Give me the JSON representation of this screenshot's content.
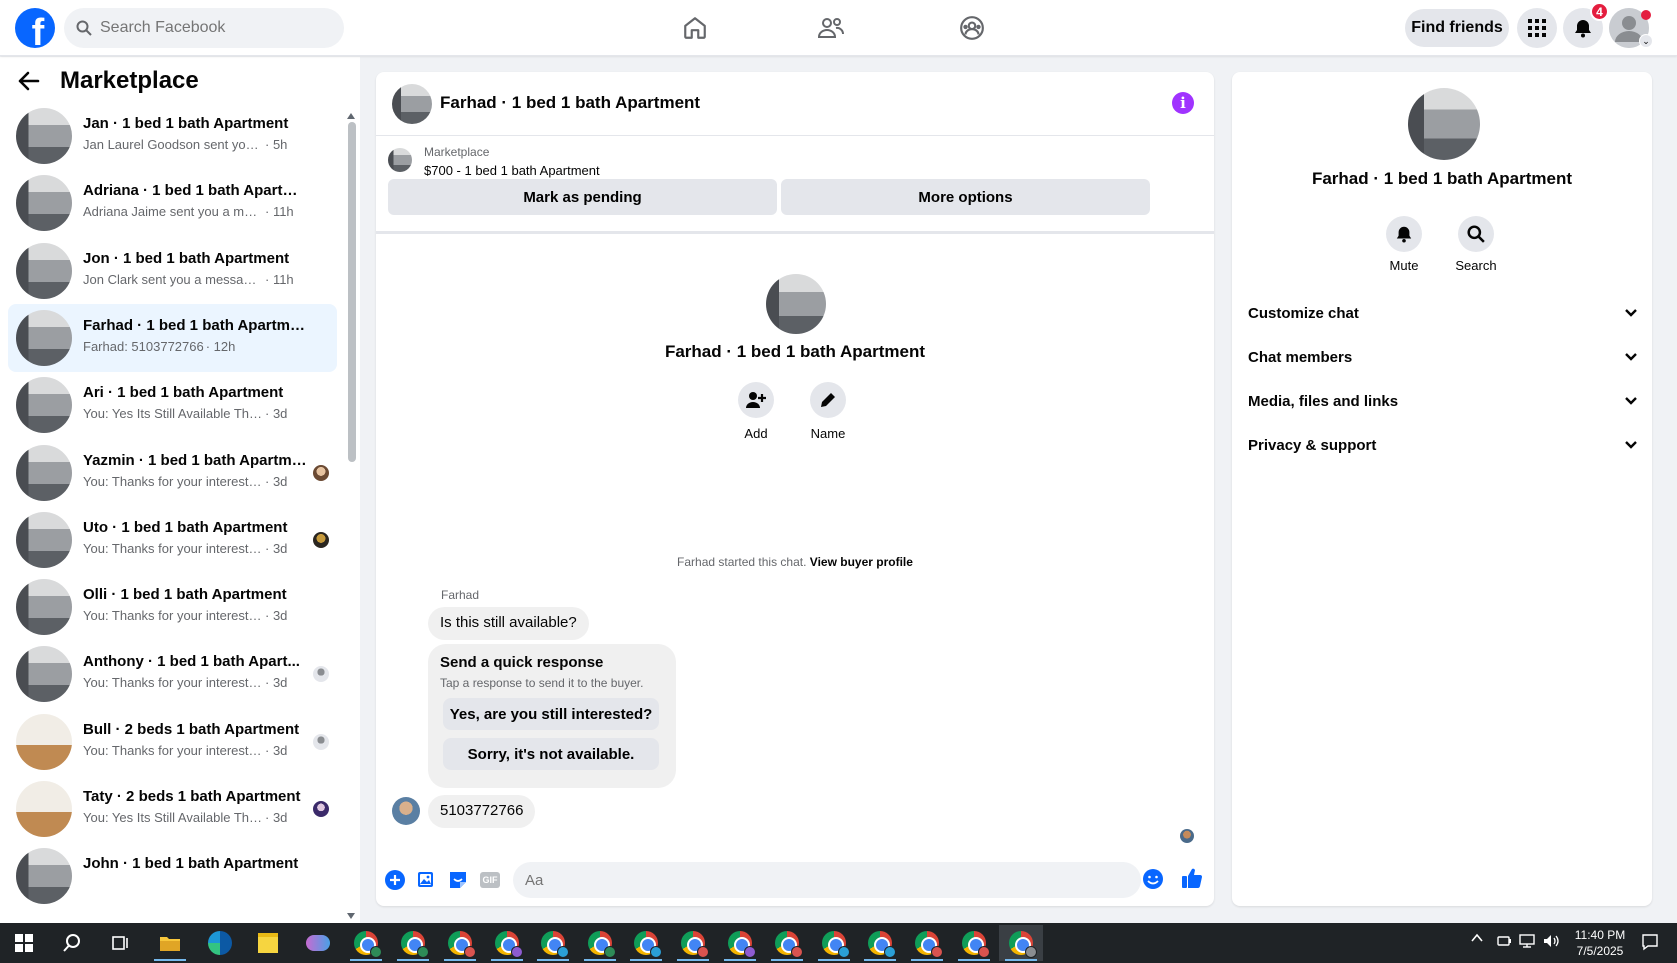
{
  "header": {
    "search_placeholder": "Search Facebook",
    "find_friends": "Find friends",
    "notification_count": "4"
  },
  "sidebar": {
    "title": "Marketplace",
    "conversations": [
      {
        "title": "Jan · 1 bed 1 bath Apartment",
        "text": "Jan Laurel Goodson sent you a mes...",
        "time": "· 5h",
        "mini": "none",
        "thumb": "apartment"
      },
      {
        "title": "Adriana · 1 bed 1 bath Apartment",
        "text": "Adriana Jaime sent you a message...",
        "time": "· 11h",
        "mini": "none",
        "thumb": "apartment"
      },
      {
        "title": "Jon · 1 bed 1 bath Apartment",
        "text": "Jon Clark sent you a message abo...",
        "time": "· 11h",
        "mini": "none",
        "thumb": "apartment"
      },
      {
        "title": "Farhad · 1 bed 1 bath Apartment",
        "text": "Farhad: 5103772766",
        "time": "· 12h",
        "mini": "none",
        "thumb": "apartment",
        "active": true
      },
      {
        "title": "Ari · 1 bed 1 bath Apartment",
        "text": "You: Yes Its Still Available Thanks fo...",
        "time": "· 3d",
        "mini": "none",
        "thumb": "apartment"
      },
      {
        "title": "Yazmin · 1 bed 1 bath Apartme...",
        "text": "You: Thanks for your interest in t...",
        "time": "· 3d",
        "mini": "photo-brown",
        "thumb": "apartment"
      },
      {
        "title": "Uto · 1 bed 1 bath Apartment",
        "text": "You: Thanks for your interest in t...",
        "time": "· 3d",
        "mini": "photo-dark",
        "thumb": "apartment"
      },
      {
        "title": "Olli · 1 bed 1 bath Apartment",
        "text": "You: Thanks for your interest in the ...",
        "time": "· 3d",
        "mini": "none",
        "thumb": "apartment"
      },
      {
        "title": "Anthony · 1 bed 1 bath Apart...",
        "text": "You: Thanks for your interest in t...",
        "time": "· 3d",
        "mini": "default-person",
        "thumb": "apartment"
      },
      {
        "title": "Bull · 2 beds 1 bath Apartment",
        "text": "You: Thanks for your interest in t...",
        "time": "· 3d",
        "mini": "default-person",
        "thumb": "room"
      },
      {
        "title": "Taty · 2 beds 1 bath Apartment",
        "text": "You: Yes Its Still Available Thanks...",
        "time": "· 3d",
        "mini": "photo-purple",
        "thumb": "room"
      },
      {
        "title": "John · 1 bed 1 bath Apartment",
        "text": "",
        "time": "",
        "mini": "none",
        "thumb": "apartment"
      }
    ]
  },
  "chat": {
    "title": "Farhad · 1 bed 1 bath Apartment",
    "listing_category": "Marketplace",
    "listing_price": "$700 - 1 bed 1 bath Apartment",
    "mark_pending": "Mark as pending",
    "more_options": "More options",
    "center_name": "Farhad · 1 bed 1 bath Apartment",
    "add_label": "Add",
    "name_label": "Name",
    "started_text": "Farhad started this chat. ",
    "view_buyer": "View buyer profile",
    "sender": "Farhad",
    "message1": "Is this still available?",
    "quick_title": "Send a quick response",
    "quick_sub": "Tap a response to send it to the buyer.",
    "quick_options": [
      "Yes, are you still interested?",
      "Sorry, it's not available."
    ],
    "message2": "5103772766",
    "composer_placeholder": "Aa"
  },
  "info": {
    "name": "Farhad · 1 bed 1 bath Apartment",
    "mute": "Mute",
    "search": "Search",
    "sections": [
      "Customize chat",
      "Chat members",
      "Media, files and links",
      "Privacy & support"
    ]
  },
  "taskbar": {
    "time": "11:40 PM",
    "date": "7/5/2025"
  },
  "colors": {
    "brand": "#0866ff",
    "accent_purple": "#a033ff",
    "active_row": "#ebf5ff"
  }
}
